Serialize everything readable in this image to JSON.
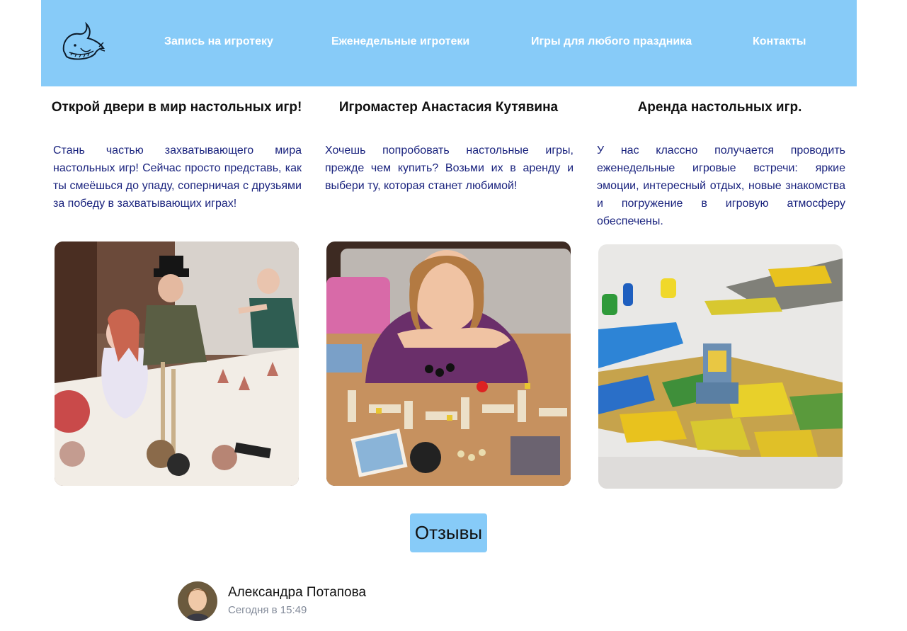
{
  "header": {
    "logo_icon": "whale-icon",
    "nav": [
      {
        "label": "Запись на игротеку"
      },
      {
        "label": "Еженедельные игротеки"
      },
      {
        "label": "Игры для любого праздника"
      },
      {
        "label": "Контакты"
      }
    ],
    "background": "#87cbf8"
  },
  "columns": [
    {
      "title": "Открой двери в мир настольных игр!",
      "text": "Стань частью захватывающего мира настольных игр! Сейчас просто представь, как ты смеёшься до упаду, соперничая с друзьями за победу в захватывающих играх!",
      "photo": "party-photo"
    },
    {
      "title": "Игромастер Анастасия Кутявина",
      "text": "Хочешь попробовать настольные игры, прежде чем купить? Возьми их в аренду и выбери ту, которая станет любимой!",
      "photo": "gamemaster-photo"
    },
    {
      "title": "Аренда настольных игр.",
      "text": "У нас классно получается проводить еженедельные игровые встречи: яркие эмоции, интересный отдых, новые знакомства и погружение в игровую атмосферу обеспечены.",
      "photo": "board-game-photo"
    }
  ],
  "reviews": {
    "button_label": "Отзывы",
    "items": [
      {
        "name": "Александра Потапова",
        "time": "Сегодня в 15:49"
      }
    ]
  },
  "colors": {
    "accent": "#87cbf8",
    "body_text": "#1a237e",
    "muted": "#828a99"
  }
}
